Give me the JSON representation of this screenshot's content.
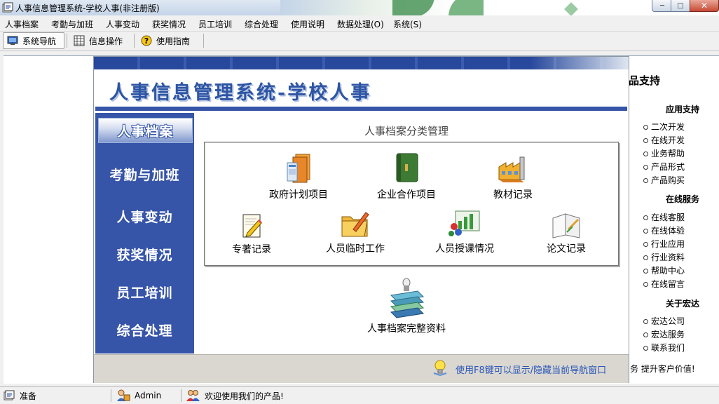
{
  "window": {
    "title": "人事信息管理系统-学校人事(非注册版)",
    "controls": {
      "minimize": "─",
      "maximize": "□",
      "close": "✕"
    }
  },
  "menu": [
    "人事档案",
    "考勤与加班",
    "人事变动",
    "获奖情况",
    "员工培训",
    "综合处理",
    "使用说明",
    "数据处理(O)",
    "系统(S)"
  ],
  "toolbar": {
    "nav_label": "系统导航",
    "info_label": "信息操作",
    "guide_label": "使用指南"
  },
  "nav": {
    "title": "人事信息管理系统-学校人事",
    "categories": [
      "人事档案",
      "考勤与加班",
      "人事变动",
      "获奖情况",
      "员工培训",
      "综合处理"
    ],
    "active_category": "人事档案",
    "section_title": "人事档案分类管理",
    "tiles": [
      "政府计划项目",
      "企业合作项目",
      "教材记录",
      "专著记录",
      "人员临时工作",
      "人员授课情况",
      "论文记录"
    ],
    "extra_tile": "人事档案完整资料",
    "hint": "使用F8键可以显示/隐藏当前导航窗口"
  },
  "support": {
    "title": "品支持",
    "sections": [
      {
        "heading": "应用支持",
        "items": [
          "二次开发",
          "在线开发",
          "业务帮助",
          "产品形式",
          "产品购买"
        ]
      },
      {
        "heading": "在线服务",
        "items": [
          "在线客服",
          "在线体验",
          "行业应用",
          "行业资料",
          "帮助中心",
          "在线留言"
        ]
      },
      {
        "heading": "关于宏达",
        "items": [
          "宏达公司",
          "宏达服务",
          "联系我们"
        ]
      }
    ],
    "partial_text": "务  提升客户价值!"
  },
  "statusbar": {
    "ready": "准备",
    "user": "Admin",
    "welcome": "欢迎使用我们的产品!"
  },
  "colors": {
    "nav_blue": "#3654a8",
    "title_blue": "#2d55a4",
    "hint_blue": "#2b56b8"
  }
}
